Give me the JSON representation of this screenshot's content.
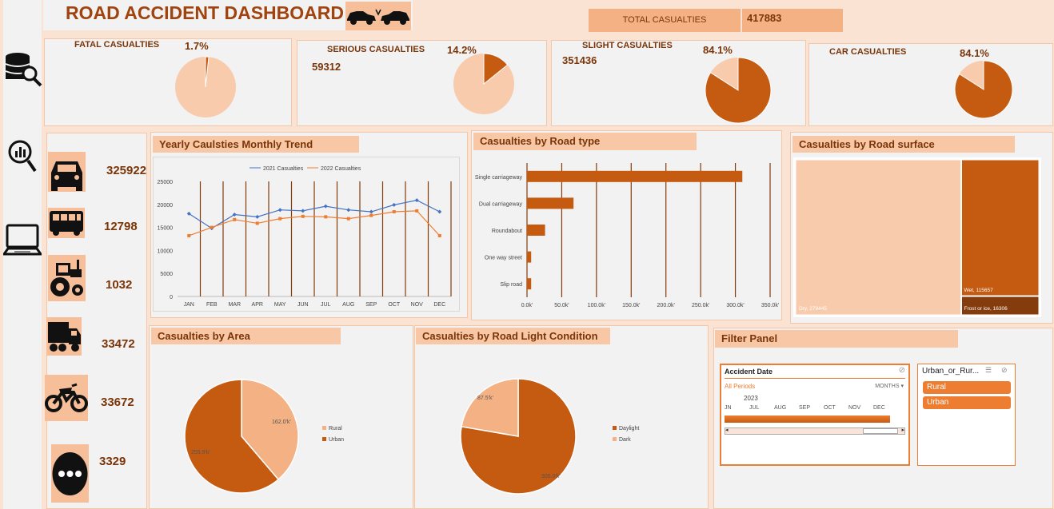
{
  "title": "ROAD ACCIDENT DASHBOARD",
  "total": {
    "label": "TOTAL CASUALTIES",
    "value": "417883"
  },
  "kpis": [
    {
      "label": "FATAL CASUALTIES",
      "pct": "1.7%",
      "value": "",
      "fraction": 0.017
    },
    {
      "label": "SERIOUS CASUALTIES",
      "pct": "14.2%",
      "value": "59312",
      "fraction": 0.142
    },
    {
      "label": "SLIGHT CASUALTIES",
      "pct": "84.1%",
      "value": "351436",
      "fraction": 0.841
    },
    {
      "label": "CAR CASUALTIES",
      "pct": "84.1%",
      "value": "",
      "fraction": 0.841
    }
  ],
  "vehicles": [
    {
      "icon": "car-icon",
      "value": "325922"
    },
    {
      "icon": "bus-icon",
      "value": "12798"
    },
    {
      "icon": "tractor-icon",
      "value": "1032"
    },
    {
      "icon": "truck-icon",
      "value": "33472"
    },
    {
      "icon": "motorbike-icon",
      "value": "33672"
    },
    {
      "icon": "other-vehicle-icon",
      "value": "3329"
    }
  ],
  "nav_icons": [
    "database-search-icon",
    "chart-search-icon",
    "laptop-icon"
  ],
  "colors": {
    "dark": "#c55a11",
    "light": "#f8cbad",
    "mid": "#f4b183",
    "brown": "#843c0c",
    "line2021": "#4472c4",
    "line2022": "#ed7d31"
  },
  "trend": {
    "title": "Yearly Caulsties Monthly Trend",
    "chart_data": {
      "type": "line",
      "categories": [
        "JAN",
        "FEB",
        "MAR",
        "APR",
        "MAY",
        "JUN",
        "JUL",
        "AUG",
        "SEP",
        "OCT",
        "NOV",
        "DEC"
      ],
      "series": [
        {
          "name": "2021 Casualties",
          "values": [
            18000,
            14800,
            17800,
            17300,
            18800,
            18600,
            19600,
            18800,
            18400,
            19900,
            20900,
            18400
          ]
        },
        {
          "name": "2022 Casualties",
          "values": [
            13200,
            15000,
            16700,
            15900,
            16900,
            17400,
            17300,
            16900,
            17600,
            18400,
            18600,
            13200
          ]
        }
      ],
      "ylim": [
        0,
        25000
      ],
      "yticks": [
        "0",
        "5000",
        "10000",
        "15000",
        "20000",
        "25000"
      ],
      "legend": "top"
    }
  },
  "roadtype": {
    "title": "Casualties by Road type",
    "chart_data": {
      "type": "bar",
      "categories": [
        "Single carriageway",
        "Dual carriageway",
        "Roundabout",
        "One way street",
        "Slip road"
      ],
      "values": [
        310000,
        67000,
        26000,
        6000,
        6000
      ],
      "xlim": [
        0,
        350000
      ],
      "xticks": [
        "0.0k'",
        "50.0k'",
        "100.0k'",
        "150.0k'",
        "200.0k'",
        "250.0k'",
        "300.0k'",
        "350.0k'"
      ]
    }
  },
  "surface": {
    "title": "Casualties by Road surface",
    "chart_data": {
      "type": "treemap",
      "items": [
        {
          "label": "Dry, 279445",
          "value": 279445
        },
        {
          "label": "Wet, 115657",
          "value": 115657
        },
        {
          "label": "Frost or ice, 16306",
          "value": 16306
        }
      ]
    }
  },
  "area": {
    "title": "Casualties by Area",
    "chart_data": {
      "type": "pie",
      "labels": [
        "Rural",
        "Urban"
      ],
      "values": [
        162.0,
        255.9
      ],
      "data_labels": [
        "162.0'k'",
        "255.9'k'"
      ]
    }
  },
  "light": {
    "title": "Casualties by Road Light Condition",
    "chart_data": {
      "type": "pie",
      "labels": [
        "Daylight",
        "Dark"
      ],
      "values": [
        305.0,
        87.5
      ],
      "data_labels": [
        "305.0'k'",
        "87.5'k'"
      ]
    }
  },
  "filter": {
    "title": "Filter Panel",
    "timeline": {
      "title": "Accident Date",
      "period": "All Periods",
      "level": "MONTHS",
      "year": "2023",
      "months": [
        "JN",
        "JUL",
        "AUG",
        "SEP",
        "OCT",
        "NOV",
        "DEC"
      ]
    },
    "slicer": {
      "title": "Urban_or_Rur...",
      "items": [
        "Rural",
        "Urban"
      ]
    }
  }
}
